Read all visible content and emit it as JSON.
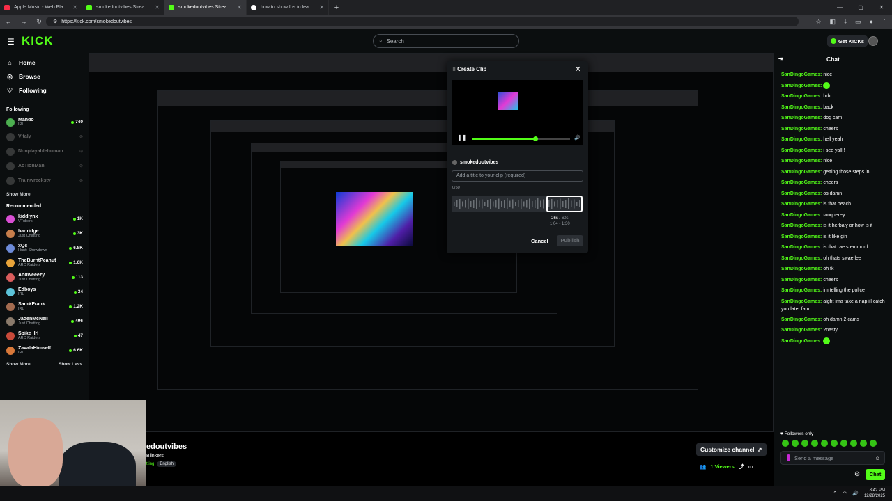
{
  "browser": {
    "tabs": [
      {
        "title": "Apple Music - Web Player",
        "color": "#fa2d48"
      },
      {
        "title": "smokedoutvibes Stream - Watc",
        "color": "#53fc18"
      },
      {
        "title": "smokedoutvibes Stream - V",
        "color": "#53fc18"
      },
      {
        "title": "how to show fps in league - Go",
        "color": "#ffffff"
      }
    ],
    "url": "https://kick.com/smokedoutvibes"
  },
  "header": {
    "logo": "KICK",
    "search_placeholder": "Search",
    "get_kicks": "Get KICKs"
  },
  "sidebar": {
    "nav": [
      {
        "label": "Home",
        "icon": "home-icon"
      },
      {
        "label": "Browse",
        "icon": "compass-icon"
      },
      {
        "label": "Following",
        "icon": "heart-icon"
      }
    ],
    "following_title": "Following",
    "following": [
      {
        "name": "Mando",
        "category": "IRL",
        "viewers": "740",
        "color": "#4caf50",
        "online": true
      },
      {
        "name": "Vitaly",
        "category": "",
        "viewers": "",
        "color": "#888",
        "online": false
      },
      {
        "name": "Nonplayablehuman",
        "category": "",
        "viewers": "",
        "color": "#888",
        "online": false
      },
      {
        "name": "AcTionMan",
        "category": "",
        "viewers": "",
        "color": "#888",
        "online": false
      },
      {
        "name": "Trainwreckstv",
        "category": "",
        "viewers": "",
        "color": "#888",
        "online": false
      }
    ],
    "following_more": "Show More",
    "recommended_title": "Recommended",
    "recommended": [
      {
        "name": "kiddlynx",
        "category": "VTubers",
        "viewers": "1K",
        "color": "#d94fd3"
      },
      {
        "name": "hanridge",
        "category": "Just Chatting",
        "viewers": "3K",
        "color": "#c77e4b"
      },
      {
        "name": "xQc",
        "category": "Hunt: Showdown",
        "viewers": "6.8K",
        "color": "#6d8bd8"
      },
      {
        "name": "TheBurntPeanut",
        "category": "ARC Raiders",
        "viewers": "1.6K",
        "color": "#e8a43a"
      },
      {
        "name": "Andweeezy",
        "category": "Just Chatting",
        "viewers": "113",
        "color": "#d95c5c"
      },
      {
        "name": "Edboys",
        "category": "IRL",
        "viewers": "34",
        "color": "#5cc3d9"
      },
      {
        "name": "SamXFrank",
        "category": "IRL",
        "viewers": "1.2K",
        "color": "#a36b4f"
      },
      {
        "name": "JadenMcNeil",
        "category": "Just Chatting",
        "viewers": "496",
        "color": "#8a7a6b"
      },
      {
        "name": "Spike_Irl",
        "category": "ARC Raiders",
        "viewers": "47",
        "color": "#c94a3a"
      },
      {
        "name": "ZavalaHimself",
        "category": "IRL",
        "viewers": "6.6K",
        "color": "#d9793a"
      }
    ],
    "show_more": "Show More",
    "show_less": "Show Less"
  },
  "stream": {
    "title": "edoutvibes",
    "subtitle": "Blinkers",
    "category": "tting",
    "tag": "English",
    "customize": "Customize channel",
    "viewers": "1 Viewers"
  },
  "clip_modal": {
    "title": "Create Clip",
    "channel": "smokedoutvibes",
    "title_placeholder": "Add a title to your clip (required)",
    "counter": "0/50",
    "duration": "26s",
    "duration_max": "/ 60s",
    "range": "1:04 - 1:30",
    "cancel": "Cancel",
    "publish": "Publish",
    "progress": 0.64
  },
  "chat": {
    "title": "Chat",
    "messages": [
      {
        "user": "SanDingoGames:",
        "text": "nice"
      },
      {
        "user": "SanDingoGames:",
        "text": "",
        "emote": true
      },
      {
        "user": "SanDingoGames:",
        "text": "brb"
      },
      {
        "user": "SanDingoGames:",
        "text": "back"
      },
      {
        "user": "SanDingoGames:",
        "text": "dog cam"
      },
      {
        "user": "SanDingoGames:",
        "text": "cheers"
      },
      {
        "user": "SanDingoGames:",
        "text": "hell yeah"
      },
      {
        "user": "SanDingoGames:",
        "text": "i see yall!!"
      },
      {
        "user": "SanDingoGames:",
        "text": "nice"
      },
      {
        "user": "SanDingoGames:",
        "text": "getting those steps in"
      },
      {
        "user": "SanDingoGames:",
        "text": "cheers"
      },
      {
        "user": "SanDingoGames:",
        "text": "os damn"
      },
      {
        "user": "SanDingoGames:",
        "text": "is that peach"
      },
      {
        "user": "SanDingoGames:",
        "text": "tanquerey"
      },
      {
        "user": "SanDingoGames:",
        "text": "is it herbaly or how is it"
      },
      {
        "user": "SanDingoGames:",
        "text": "is it like gin"
      },
      {
        "user": "SanDingoGames:",
        "text": "is that rae sremmurd"
      },
      {
        "user": "SanDingoGames:",
        "text": "oh thats swae lee"
      },
      {
        "user": "SanDingoGames:",
        "text": "oh fk"
      },
      {
        "user": "SanDingoGames:",
        "text": "cheers"
      },
      {
        "user": "SanDingoGames:",
        "text": "im telling the police"
      },
      {
        "user": "SanDingoGames:",
        "text": "aight ima take a nap ill catch you later fam",
        "wrap": true
      },
      {
        "user": "SanDingoGames:",
        "text": "oh damn 2 cams"
      },
      {
        "user": "SanDingoGames:",
        "text": "2nasty"
      },
      {
        "user": "SanDingoGames:",
        "text": "",
        "emote": true
      }
    ],
    "followers_only": "Followers only",
    "send_placeholder": "Send a message",
    "chat_button": "Chat"
  },
  "taskbar": {
    "time": "8:42 PM",
    "date": "12/28/2025"
  }
}
